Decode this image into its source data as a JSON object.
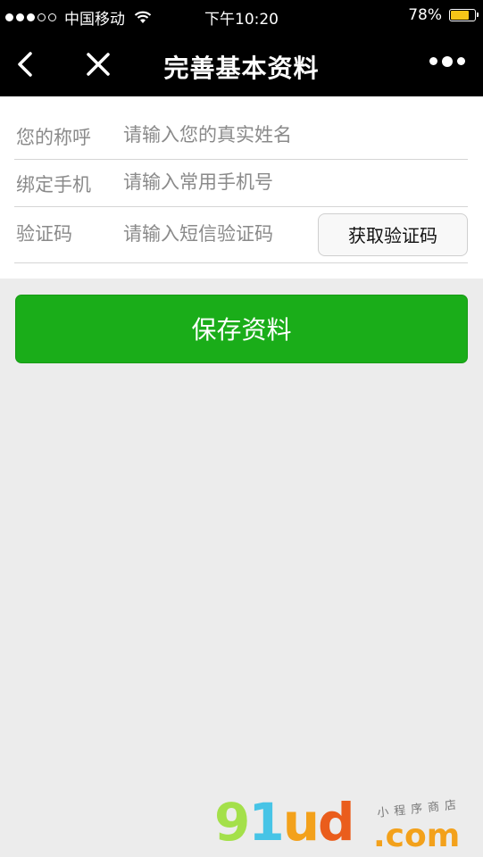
{
  "status_bar": {
    "carrier": "中国移动",
    "time": "下午10:20",
    "battery_percent": "78%",
    "battery_level": 0.78,
    "signal_bars_filled": 3,
    "signal_bars_total": 5
  },
  "nav": {
    "title": "完善基本资料",
    "back_icon": "chevron-left-icon",
    "close_icon": "close-icon",
    "more_icon": "more-dots-icon"
  },
  "form": {
    "nickname": {
      "label": "您的称呼",
      "placeholder": "请输入您的真实姓名",
      "value": ""
    },
    "phone": {
      "label": "绑定手机",
      "placeholder": "请输入常用手机号",
      "value": ""
    },
    "code": {
      "label": "验证码",
      "placeholder": "请输入短信验证码",
      "value": "",
      "button_label": "获取验证码"
    }
  },
  "save_button_label": "保存资料",
  "watermark": {
    "logo_parts": [
      "9",
      "1",
      "u",
      "d"
    ],
    "domain_suffix": ".com",
    "tagline": "小程序商店"
  },
  "colors": {
    "accent_green": "#1aad19",
    "battery_fill": "#f5c518",
    "background": "#ececec"
  }
}
